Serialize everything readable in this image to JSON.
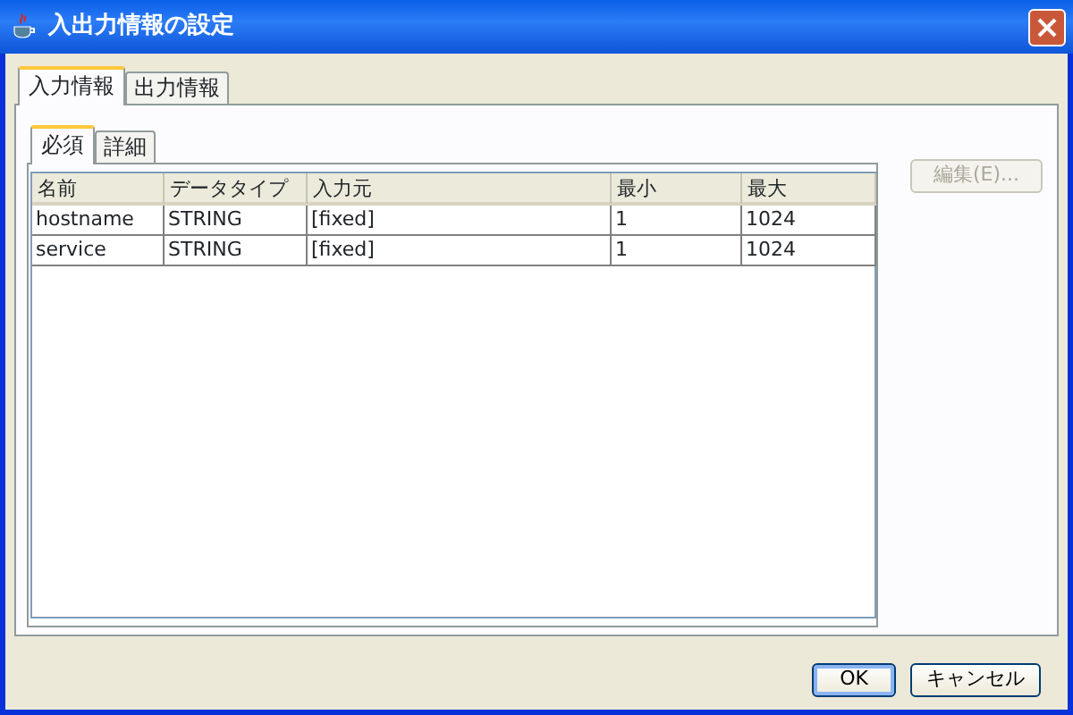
{
  "window": {
    "title": "入出力情報の設定"
  },
  "tabs": [
    {
      "label": "入力情報",
      "selected": true
    },
    {
      "label": "出力情報",
      "selected": false
    }
  ],
  "subtabs": [
    {
      "label": "必須",
      "selected": true
    },
    {
      "label": "詳細",
      "selected": false
    }
  ],
  "table": {
    "columns": [
      "名前",
      "データタイプ",
      "入力元",
      "最小",
      "最大"
    ],
    "rows": [
      [
        "hostname",
        "STRING",
        "[fixed]",
        "1",
        "1024"
      ],
      [
        "service",
        "STRING",
        "[fixed]",
        "1",
        "1024"
      ]
    ]
  },
  "side_button": {
    "label": "編集(E)...",
    "disabled": true
  },
  "buttons": [
    {
      "label": "OK",
      "default": true
    },
    {
      "label": "キャンセル",
      "default": false
    }
  ]
}
